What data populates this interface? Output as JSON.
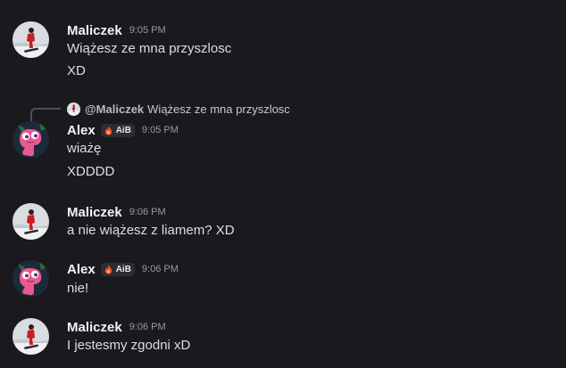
{
  "messages": [
    {
      "author": "Maliczek",
      "time": "9:05 PM",
      "lines": [
        "Wiążesz ze mna przyszlosc",
        "XD"
      ]
    },
    {
      "reply": {
        "author": "@Maliczek",
        "text": "Wiążesz ze mna przyszlosc"
      },
      "author": "Alex",
      "tag": "AiB",
      "time": "9:05 PM",
      "lines": [
        "wiażę",
        "XDDDD"
      ]
    },
    {
      "author": "Maliczek",
      "time": "9:06 PM",
      "lines": [
        "a nie wiążesz z liamem? XD"
      ]
    },
    {
      "author": "Alex",
      "tag": "AiB",
      "time": "9:06 PM",
      "lines": [
        "nie!"
      ]
    },
    {
      "author": "Maliczek",
      "time": "9:06 PM",
      "lines": [
        "I jestesmy zgodni xD"
      ]
    }
  ],
  "icons": {
    "maliczek_avatar": "snowboarder-avatar",
    "alex_avatar": "pink-creature-avatar",
    "tag_icon": "flame-icon"
  },
  "colors": {
    "background": "#1a1a1e",
    "username": "#f2f3f5",
    "text": "#dbdee1",
    "timestamp": "#949ba4",
    "tag_bg": "#2b2d31"
  }
}
